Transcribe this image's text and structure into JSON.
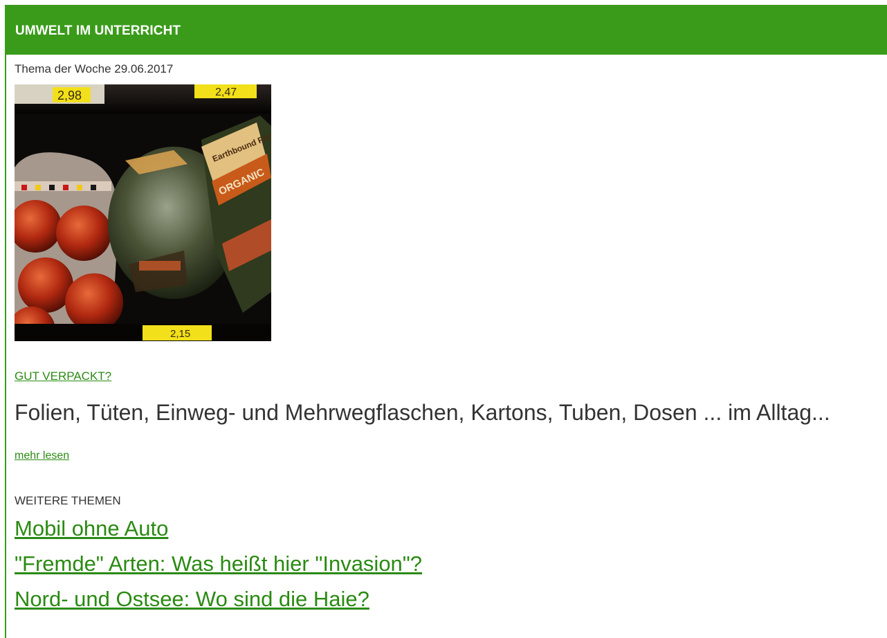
{
  "header": {
    "title": "UMWELT IM UNTERRICHT"
  },
  "feature": {
    "date_line": "Thema der Woche 29.06.2017",
    "image_alt": "Verpackte Lebensmittel im Supermarktregal",
    "price_tags": [
      "2,98",
      "2,47",
      "2,15"
    ],
    "package_labels": [
      "ORGANIC",
      "Earthbound Farm"
    ],
    "title_link": "GUT VERPACKT?",
    "teaser": "Folien, Tüten, Einweg- und Mehrwegflaschen, Kartons, Tuben, Dosen ... im Alltag...",
    "more_link": "mehr lesen"
  },
  "more_topics": {
    "heading": "WEITERE THEMEN",
    "items": [
      "Mobil ohne Auto",
      "\"Fremde\" Arten: Was heißt hier \"Invasion\"?",
      "Nord- und Ostsee: Wo sind die Haie?"
    ]
  },
  "colors": {
    "brand_green": "#3a9b1a",
    "link_green": "#2a8a12",
    "text": "#333333"
  }
}
